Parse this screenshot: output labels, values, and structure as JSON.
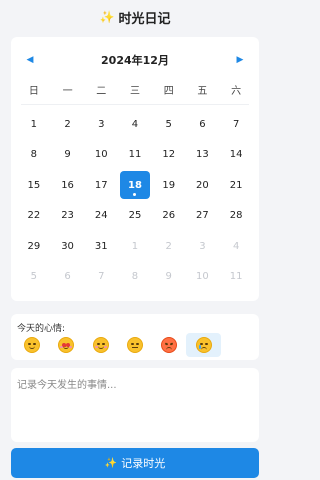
{
  "app": {
    "title": "时光日记",
    "title_icon": "sparkles-icon",
    "title_icon_glyph": "✨"
  },
  "calendar": {
    "month_label": "2024年12月",
    "prev_glyph": "◀",
    "next_glyph": "▶",
    "weekdays": [
      "日",
      "一",
      "二",
      "三",
      "四",
      "五",
      "六"
    ],
    "days": [
      {
        "n": "1"
      },
      {
        "n": "2"
      },
      {
        "n": "3"
      },
      {
        "n": "4"
      },
      {
        "n": "5"
      },
      {
        "n": "6"
      },
      {
        "n": "7"
      },
      {
        "n": "8"
      },
      {
        "n": "9"
      },
      {
        "n": "10"
      },
      {
        "n": "11"
      },
      {
        "n": "12"
      },
      {
        "n": "13"
      },
      {
        "n": "14"
      },
      {
        "n": "15"
      },
      {
        "n": "16"
      },
      {
        "n": "17"
      },
      {
        "n": "18",
        "selected": true,
        "has_entry": true
      },
      {
        "n": "19"
      },
      {
        "n": "20"
      },
      {
        "n": "21"
      },
      {
        "n": "22"
      },
      {
        "n": "23"
      },
      {
        "n": "24"
      },
      {
        "n": "25"
      },
      {
        "n": "26"
      },
      {
        "n": "27"
      },
      {
        "n": "28"
      },
      {
        "n": "29"
      },
      {
        "n": "30"
      },
      {
        "n": "31"
      },
      {
        "n": "1",
        "muted": true
      },
      {
        "n": "2",
        "muted": true
      },
      {
        "n": "3",
        "muted": true
      },
      {
        "n": "4",
        "muted": true
      },
      {
        "n": "5",
        "muted": true
      },
      {
        "n": "6",
        "muted": true
      },
      {
        "n": "7",
        "muted": true
      },
      {
        "n": "8",
        "muted": true
      },
      {
        "n": "9",
        "muted": true
      },
      {
        "n": "10",
        "muted": true
      },
      {
        "n": "11",
        "muted": true
      }
    ],
    "accent_color": "#1e88e5"
  },
  "mood": {
    "label": "今天的心情:",
    "options": [
      {
        "name": "smiling-face-icon",
        "style": "smile"
      },
      {
        "name": "smiling-face-with-hearts-icon",
        "style": "love"
      },
      {
        "name": "relieved-face-icon",
        "style": "relieved"
      },
      {
        "name": "expressionless-face-icon",
        "style": "flat"
      },
      {
        "name": "angry-face-icon",
        "style": "angry"
      },
      {
        "name": "crying-face-icon",
        "style": "sad",
        "selected": true
      }
    ]
  },
  "note": {
    "placeholder": "记录今天发生的事情..."
  },
  "actions": {
    "save_label": "记录时光",
    "save_icon_glyph": "✨"
  }
}
